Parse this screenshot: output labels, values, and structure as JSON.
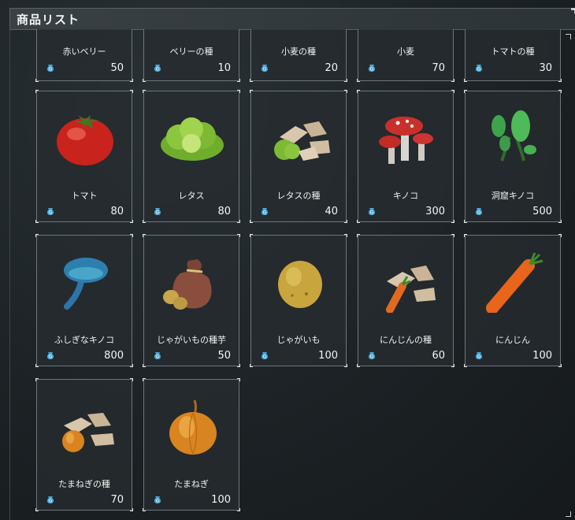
{
  "header": {
    "title": "商品リスト"
  },
  "currency_icon": "gold-coin-bag-icon",
  "colors": {
    "card_border": "#6f777c",
    "coin": "#4aa8d8"
  },
  "top_row": [
    {
      "name": "赤いベリー",
      "price": "50"
    },
    {
      "name": "ベリーの種",
      "price": "10"
    },
    {
      "name": "小麦の種",
      "price": "20"
    },
    {
      "name": "小麦",
      "price": "70"
    },
    {
      "name": "トマトの種",
      "price": "30"
    }
  ],
  "items": [
    {
      "name": "トマト",
      "price": "80",
      "icon": "tomato-icon"
    },
    {
      "name": "レタス",
      "price": "80",
      "icon": "lettuce-icon"
    },
    {
      "name": "レタスの種",
      "price": "40",
      "icon": "lettuce-seeds-icon"
    },
    {
      "name": "キノコ",
      "price": "300",
      "icon": "mushroom-icon"
    },
    {
      "name": "洞窟キノコ",
      "price": "500",
      "icon": "cave-mushroom-icon"
    },
    {
      "name": "ふしぎなキノコ",
      "price": "800",
      "icon": "mysterious-mushroom-icon"
    },
    {
      "name": "じゃがいもの種芋",
      "price": "50",
      "icon": "seed-potato-sack-icon"
    },
    {
      "name": "じゃがいも",
      "price": "100",
      "icon": "potato-icon"
    },
    {
      "name": "にんじんの種",
      "price": "60",
      "icon": "carrot-seeds-icon"
    },
    {
      "name": "にんじん",
      "price": "100",
      "icon": "carrot-icon"
    },
    {
      "name": "たまねぎの種",
      "price": "70",
      "icon": "onion-seeds-icon"
    },
    {
      "name": "たまねぎ",
      "price": "100",
      "icon": "onion-icon"
    }
  ]
}
